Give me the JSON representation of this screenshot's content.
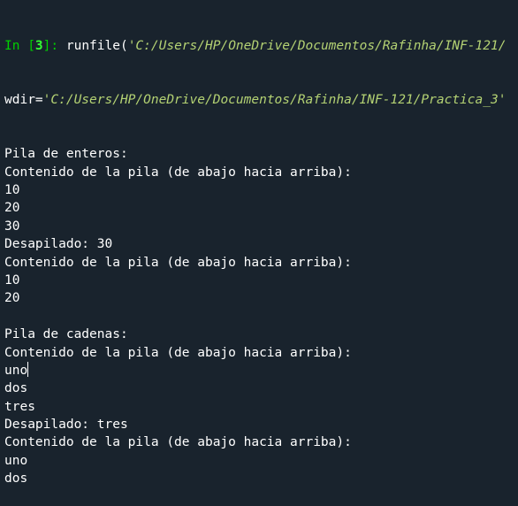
{
  "console": {
    "prompt_prefix": "In [",
    "prompt_number": "3",
    "prompt_suffix": "]: ",
    "command_func": "runfile(",
    "command_arg1": "'C:/Users/HP/OneDrive/Documentos/Rafinha/INF-121/",
    "command_kw": "wdir=",
    "command_arg2": "'C:/Users/HP/OneDrive/Documentos/Rafinha/INF-121/Practica_3'",
    "output": [
      "Pila de enteros:",
      "Contenido de la pila (de abajo hacia arriba):",
      "10",
      "20",
      "30",
      "Desapilado: 30",
      "Contenido de la pila (de abajo hacia arriba):",
      "10",
      "20",
      "",
      "Pila de cadenas:",
      "Contenido de la pila (de abajo hacia arriba):",
      "uno",
      "dos",
      "tres",
      "Desapilado: tres",
      "Contenido de la pila (de abajo hacia arriba):",
      "uno",
      "dos"
    ]
  },
  "colors": {
    "background": "#19232d",
    "prompt": "#00d000",
    "string": "#b4d273",
    "text": "#ffffff"
  }
}
